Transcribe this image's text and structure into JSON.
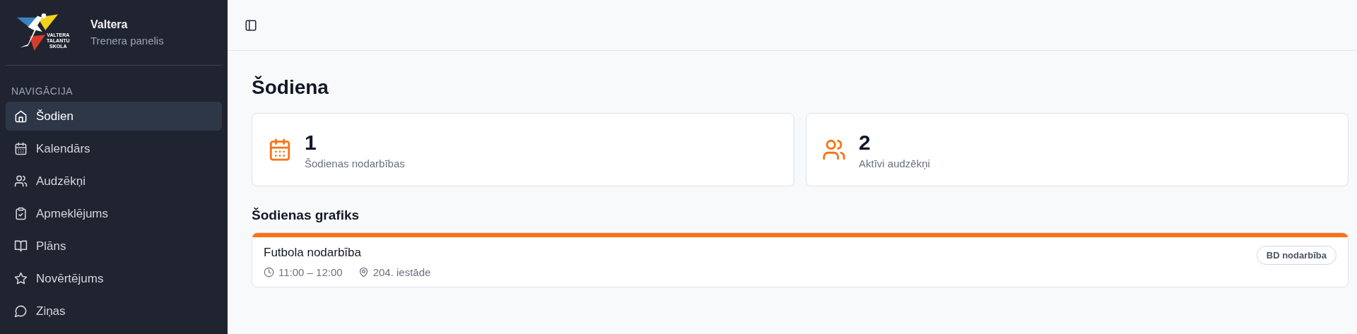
{
  "sidebar": {
    "logo_text": [
      "VALTERA",
      "TALANTU",
      "SKOLA"
    ],
    "brand": "Valtera",
    "subtitle": "Trenera panelis",
    "section_label": "NAVIGĀCIJA",
    "items": [
      {
        "label": "Šodien",
        "selected": true
      },
      {
        "label": "Kalendārs",
        "selected": false
      },
      {
        "label": "Audzēkņi",
        "selected": false
      },
      {
        "label": "Apmeklējums",
        "selected": false
      },
      {
        "label": "Plāns",
        "selected": false
      },
      {
        "label": "Novērtējums",
        "selected": false
      },
      {
        "label": "Ziņas",
        "selected": false
      }
    ]
  },
  "page_title": "Šodiena",
  "stats": [
    {
      "value": "1",
      "label": "Šodienas nodarbības"
    },
    {
      "value": "2",
      "label": "Aktīvi audzēkņi"
    }
  ],
  "schedule": {
    "heading": "Šodienas grafiks",
    "events": [
      {
        "title": "Futbola nodarbība",
        "time": "11:00 – 12:00",
        "place": "204. iestāde",
        "tag": "BD nodarbība",
        "color": "#f97316"
      }
    ]
  }
}
